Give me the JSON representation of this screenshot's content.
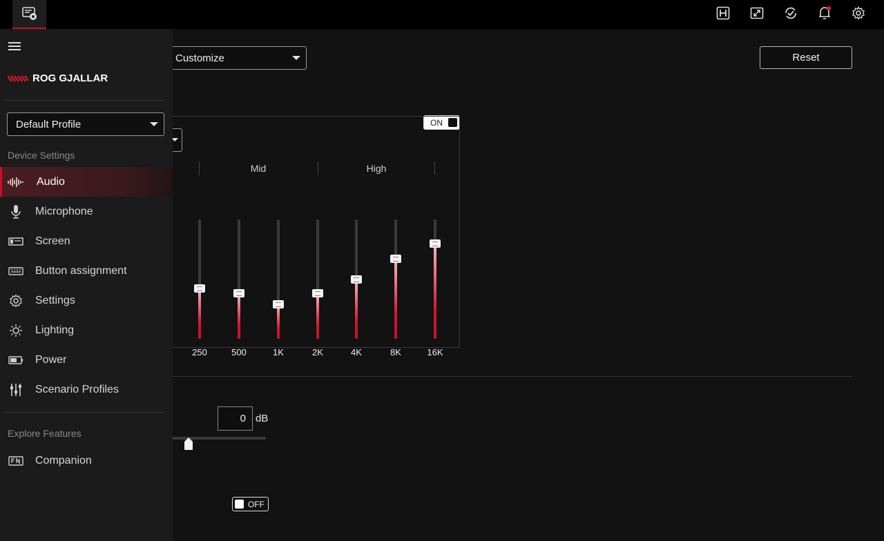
{
  "topbar": {
    "device_icon": "headset-device-icon",
    "icons": [
      "armoury-h-icon",
      "window-resize-icon",
      "update-check-icon",
      "notification-bell-icon",
      "settings-gear-icon"
    ]
  },
  "main": {
    "mode_select": "Customize",
    "reset_label": "Reset",
    "eq_toggle": "ON",
    "bands": [
      "Mid",
      "High"
    ],
    "eq": [
      {
        "freq": "250",
        "level": 0.42
      },
      {
        "freq": "500",
        "level": 0.38
      },
      {
        "freq": "1K",
        "level": 0.29
      },
      {
        "freq": "2K",
        "level": 0.38
      },
      {
        "freq": "4K",
        "level": 0.5
      },
      {
        "freq": "8K",
        "level": 0.67
      },
      {
        "freq": "16K",
        "level": 0.8
      }
    ],
    "gain_value": "0",
    "gain_unit": "dB",
    "gain_level": 0.12,
    "bottom_toggle": "OFF"
  },
  "sidebar": {
    "brand": "ROG GJALLAR",
    "profile": "Default Profile",
    "device_settings_label": "Device Settings",
    "items": [
      {
        "label": "Audio",
        "icon": "audio-waveform-icon",
        "active": true
      },
      {
        "label": "Microphone",
        "icon": "microphone-icon"
      },
      {
        "label": "Screen",
        "icon": "screen-icon"
      },
      {
        "label": "Button assignment",
        "icon": "keyboard-icon"
      },
      {
        "label": "Settings",
        "icon": "gear-icon"
      },
      {
        "label": "Lighting",
        "icon": "lighting-icon"
      },
      {
        "label": "Power",
        "icon": "battery-icon"
      },
      {
        "label": "Scenario Profiles",
        "icon": "sliders-icon"
      }
    ],
    "explore_label": "Explore Features",
    "explore_items": [
      {
        "label": "Companion",
        "icon": "fn-companion-icon"
      }
    ]
  },
  "colors": {
    "accent": "#c8102e",
    "background": "#121212",
    "sidebar": "#1b1b1b"
  }
}
